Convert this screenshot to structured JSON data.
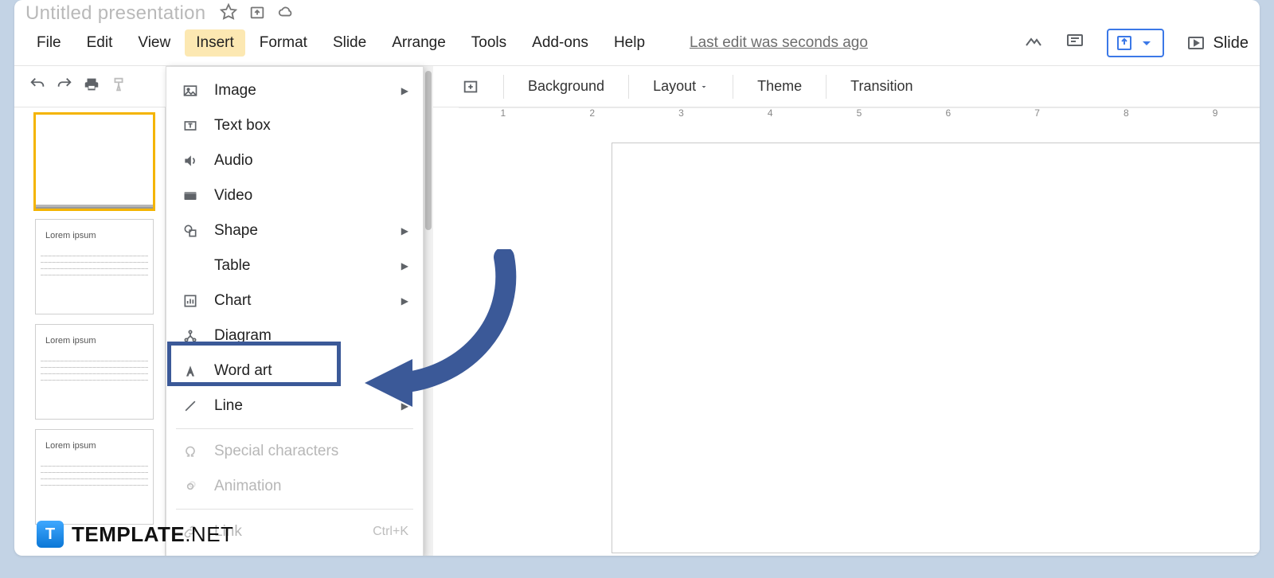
{
  "header": {
    "doc_title": "Untitled presentation",
    "last_edit": "Last edit was seconds ago",
    "present_label": "Slide"
  },
  "menubar": {
    "items": [
      "File",
      "Edit",
      "View",
      "Insert",
      "Format",
      "Slide",
      "Arrange",
      "Tools",
      "Add-ons",
      "Help"
    ],
    "active_index": 3
  },
  "insert_menu": {
    "items": [
      {
        "label": "Image",
        "icon": "image-icon",
        "submenu": true
      },
      {
        "label": "Text box",
        "icon": "textbox-icon"
      },
      {
        "label": "Audio",
        "icon": "audio-icon"
      },
      {
        "label": "Video",
        "icon": "video-icon"
      },
      {
        "label": "Shape",
        "icon": "shape-icon",
        "submenu": true
      },
      {
        "label": "Table",
        "icon": "table-icon",
        "submenu": true
      },
      {
        "label": "Chart",
        "icon": "chart-icon",
        "submenu": true
      },
      {
        "label": "Diagram",
        "icon": "diagram-icon"
      },
      {
        "label": "Word art",
        "icon": "wordart-icon",
        "highlight": true
      },
      {
        "label": "Line",
        "icon": "line-icon",
        "submenu": true
      },
      {
        "sep": true
      },
      {
        "label": "Special characters",
        "icon": "omega-icon",
        "disabled": true
      },
      {
        "label": "Animation",
        "icon": "animation-icon",
        "disabled": true
      },
      {
        "sep": true
      },
      {
        "label": "Link",
        "icon": "link-icon",
        "disabled": true,
        "shortcut": "Ctrl+K"
      }
    ]
  },
  "canvas_toolbar": {
    "background": "Background",
    "layout": "Layout",
    "theme": "Theme",
    "transition": "Transition"
  },
  "ruler": {
    "ticks": [
      "1",
      "2",
      "3",
      "4",
      "5",
      "6",
      "7",
      "8",
      "9"
    ]
  },
  "thumbnails": {
    "placeholder": "Lorem ipsum"
  },
  "watermark": {
    "brand": "TEMPLATE",
    "suffix": ".NET",
    "logo_letter": "T"
  }
}
